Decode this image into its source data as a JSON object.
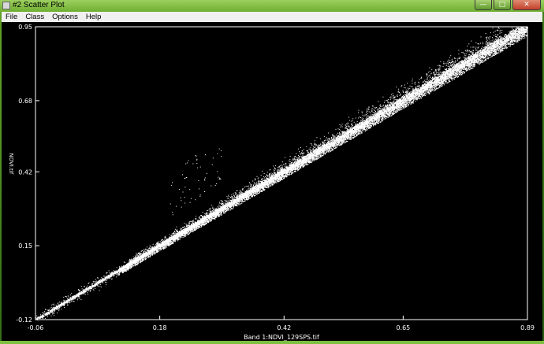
{
  "window": {
    "title": "#2 Scatter Plot",
    "controls": {
      "minimize": "—",
      "maximize": "□",
      "close": "✕"
    }
  },
  "menu": {
    "items": [
      "File",
      "Class",
      "Options",
      "Help"
    ]
  },
  "chart_data": {
    "type": "scatter",
    "xlabel": "Band 1:NDVI_129SPS.tif",
    "ylabel": "NDVI.tif",
    "xlim": [
      -0.06,
      0.89
    ],
    "ylim": [
      -0.12,
      0.95
    ],
    "x_ticks": [
      "-0.06",
      "0.18",
      "0.42",
      "0.65",
      "0.89"
    ],
    "y_ticks": [
      "-0.12",
      "0.15",
      "0.42",
      "0.68",
      "0.95"
    ],
    "background": "#000000",
    "point_color": "#ffffff",
    "grid": false,
    "main_trend": {
      "x": [
        -0.06,
        0.89
      ],
      "y": [
        -0.12,
        0.95
      ]
    }
  }
}
